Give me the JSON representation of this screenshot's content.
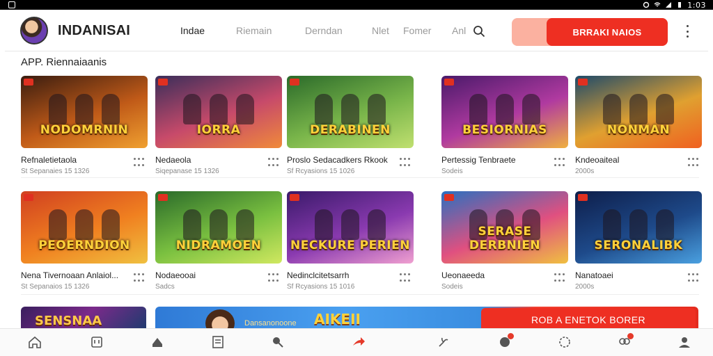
{
  "status_bar": {
    "time": "1:03"
  },
  "header": {
    "brand": "INDANISAI",
    "nav": [
      "Indae",
      "Riemain",
      "Derndan",
      "Nlet",
      "Fomer",
      "Anl"
    ],
    "cta_label": "BRRAKI NAIOS"
  },
  "section_title": "APP. Riennaiaanis",
  "cards": [
    {
      "title": "Refnaletietaola",
      "sub": "St Sepanaies 15 1326",
      "logo": "NODOMRNIN",
      "colors": [
        "#3a1d10",
        "#c05a18",
        "#f0a030"
      ]
    },
    {
      "title": "Nedaeola",
      "sub": "Siqepanase 15 1326",
      "logo": "IORRA",
      "colors": [
        "#3a2e5a",
        "#c74a6a",
        "#f08a3a"
      ]
    },
    {
      "title": "Proslo Sedacadkers Rkook",
      "sub": "Sf Rcyasions 15 1026",
      "logo": "DERABINEN",
      "colors": [
        "#2b6a2a",
        "#79b54a",
        "#c0e070"
      ]
    },
    {
      "title": "Pertessig Tenbraete",
      "sub": "Sodeis",
      "logo": "BESIORNIAS",
      "colors": [
        "#4a1a6a",
        "#b03aa0",
        "#f0b040"
      ]
    },
    {
      "title": "Kndeoaiteal",
      "sub": "2000s",
      "logo": "NONMAN",
      "colors": [
        "#1e4a6a",
        "#e0a030",
        "#f06020"
      ]
    },
    {
      "title": "Nena Tivernoaan Anlaiol...",
      "sub": "St Sepanaios 15 1326",
      "logo": "PEOERNDION",
      "colors": [
        "#d04020",
        "#f08020",
        "#f0c040"
      ]
    },
    {
      "title": "Nodaeooai",
      "sub": "Sadcs",
      "logo": "NIDRAMOEN",
      "colors": [
        "#2a6a2a",
        "#7ac040",
        "#d0e860"
      ]
    },
    {
      "title": "Nedinclcitetsarrh",
      "sub": "Sf Rcyasions 15 1016",
      "logo": "NECKURE PERIEN",
      "colors": [
        "#3a1a6a",
        "#8a3ab0",
        "#f0a0d0"
      ]
    },
    {
      "title": "Ueonaeeda",
      "sub": "Sodeis",
      "logo": "SERASE DERBNIEN",
      "colors": [
        "#2a70c0",
        "#e05080",
        "#f0c040"
      ]
    },
    {
      "title": "Nanatoaei",
      "sub": "2000s",
      "logo": "SERONALIBK",
      "colors": [
        "#0e1e4a",
        "#1e4a8a",
        "#4aa0e0"
      ]
    }
  ],
  "bottom_partial_card_logo": "SENSNAA",
  "banner": {
    "small": "Dansanonoone",
    "mid": "AIKEII",
    "button": "ROB A ENETOK BORER"
  },
  "bottom_nav": [
    {
      "icon": "home-icon",
      "label": ""
    },
    {
      "icon": "store-icon",
      "label": ""
    },
    {
      "icon": "speech-icon",
      "label": ""
    },
    {
      "icon": "list-icon",
      "label": ""
    },
    {
      "icon": "search-icon",
      "label": ""
    },
    {
      "icon": "share-icon",
      "label": ""
    },
    {
      "icon": "link-icon",
      "label": ""
    },
    {
      "icon": "chat-icon",
      "label": ""
    },
    {
      "icon": "settings-icon",
      "label": ""
    },
    {
      "icon": "people-icon",
      "label": ""
    },
    {
      "icon": "profile-icon",
      "label": ""
    }
  ],
  "colors": {
    "accent": "#ee2f22",
    "accent_soft": "#fbb1a0"
  }
}
